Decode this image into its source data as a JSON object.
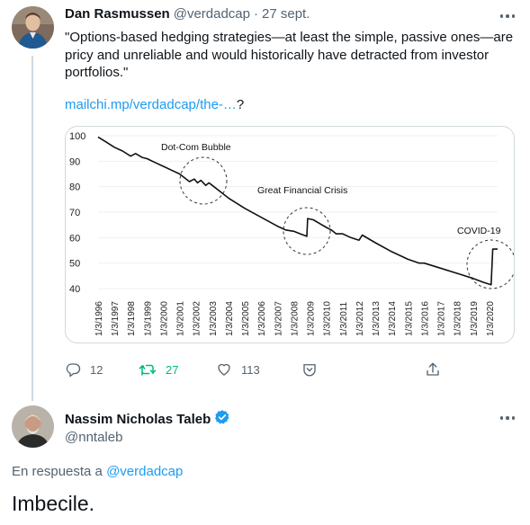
{
  "tweet": {
    "author_name": "Dan Rasmussen",
    "author_handle": "@verdadcap",
    "separator": "·",
    "date": "27 sept.",
    "text": "\"Options-based hedging strategies—at least the simple, passive ones—are pricy and unreliable and would historically have detracted from investor portfolios.\"",
    "link_text": "mailchi.mp/verdadcap/the-…",
    "link_suffix": "?",
    "actions": {
      "reply_count": "12",
      "retweet_count": "27",
      "like_count": "113"
    }
  },
  "chart_data": {
    "type": "line",
    "title": "",
    "xlabel": "",
    "ylabel": "",
    "ylim": [
      40,
      100
    ],
    "yticks": [
      "100",
      "90",
      "80",
      "70",
      "60",
      "50",
      "40"
    ],
    "categories": [
      "1/3/1996",
      "1/3/1997",
      "1/3/1998",
      "1/3/1999",
      "1/3/2000",
      "1/3/2001",
      "1/3/2002",
      "1/3/2003",
      "1/3/2004",
      "1/3/2005",
      "1/3/2006",
      "1/3/2007",
      "1/3/2008",
      "1/3/2009",
      "1/3/2010",
      "1/3/2011",
      "1/3/2012",
      "1/3/2013",
      "1/3/2014",
      "1/3/2015",
      "1/3/2016",
      "1/3/2017",
      "1/3/2018",
      "1/3/2019",
      "1/3/2020"
    ],
    "series": [
      {
        "x": [
          1996,
          1996.5,
          1997,
          1997.5,
          1998,
          1998.3,
          1998.7,
          1999,
          1999.5,
          2000,
          2000.5,
          2001,
          2001.3,
          2001.6,
          2001.9,
          2002.1,
          2002.3,
          2002.6,
          2002.8,
          2003,
          2003.5,
          2004,
          2005,
          2006,
          2007,
          2007.5,
          2008,
          2008.4,
          2008.8,
          2008.85,
          2009.2,
          2009.6,
          2010,
          2010.3,
          2010.6,
          2011,
          2011.5,
          2012,
          2012.2,
          2013,
          2014,
          2015,
          2015.7,
          2016,
          2017,
          2018,
          2019,
          2019.6,
          2020.1,
          2020.2,
          2020.5
        ],
        "values": [
          99.5,
          97.5,
          95.5,
          94,
          92,
          93,
          91.5,
          91,
          89.5,
          88,
          86.5,
          85,
          83.5,
          82,
          83,
          81.5,
          82.5,
          80.5,
          81.5,
          80.5,
          78,
          75.5,
          71.5,
          68,
          64.5,
          63,
          62.5,
          61.5,
          60.5,
          67.5,
          67,
          65.5,
          64,
          63,
          61.5,
          61.5,
          60,
          59,
          61,
          58,
          54.5,
          51.5,
          50,
          50,
          48,
          46,
          44,
          42.5,
          41.5,
          55.5,
          55.5
        ]
      }
    ],
    "annotations": [
      "Dot-Com Bubble",
      "Great Financial Crisis",
      "COVID-19"
    ],
    "grid": true,
    "legend": "none"
  },
  "reply": {
    "author_name": "Nassim Nicholas Taleb",
    "author_handle": "@nntaleb",
    "reply_to_label": "En respuesta a",
    "reply_to_handle": "@verdadcap",
    "text": "Imbecile."
  }
}
